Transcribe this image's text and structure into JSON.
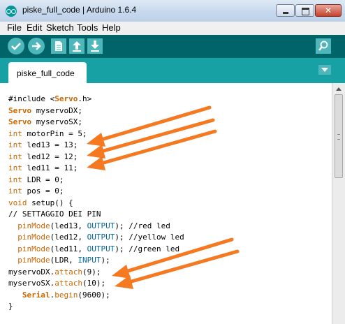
{
  "window": {
    "title": "piske_full_code | Arduino 1.6.4"
  },
  "menu": {
    "items": [
      "File",
      "Edit",
      "Sketch",
      "Tools",
      "Help"
    ]
  },
  "toolbar": {
    "verify_icon": "check-icon",
    "upload_icon": "arrow-right-icon",
    "new_icon": "new-document-icon",
    "open_icon": "arrow-up-icon",
    "save_icon": "arrow-down-icon",
    "serial_monitor_icon": "magnifier-icon"
  },
  "tabs": {
    "active": "piske_full_code"
  },
  "code": {
    "lines": [
      [
        {
          "t": "#include <",
          "s": "plain"
        },
        {
          "t": "Servo",
          "s": "class"
        },
        {
          "t": ".h>",
          "s": "plain"
        }
      ],
      [
        {
          "t": "Servo",
          "s": "class"
        },
        {
          "t": " myservoDX;",
          "s": "plain"
        }
      ],
      [
        {
          "t": "Servo",
          "s": "class"
        },
        {
          "t": " myservoSX;",
          "s": "plain"
        }
      ],
      [
        {
          "t": "int",
          "s": "type"
        },
        {
          "t": " motorPin = 5;",
          "s": "plain"
        }
      ],
      [
        {
          "t": "int",
          "s": "type"
        },
        {
          "t": " led13 = 13;",
          "s": "plain"
        }
      ],
      [
        {
          "t": "int",
          "s": "type"
        },
        {
          "t": " led12 = 12;",
          "s": "plain"
        }
      ],
      [
        {
          "t": "int",
          "s": "type"
        },
        {
          "t": " led11 = 11;",
          "s": "plain"
        }
      ],
      [
        {
          "t": "int",
          "s": "type"
        },
        {
          "t": " LDR = 0;",
          "s": "plain"
        }
      ],
      [
        {
          "t": "int",
          "s": "type"
        },
        {
          "t": " pos = 0;",
          "s": "plain"
        }
      ],
      [
        {
          "t": "void",
          "s": "type"
        },
        {
          "t": " setup",
          "s": "plain"
        },
        {
          "t": "() {",
          "s": "plain"
        }
      ],
      [
        {
          "t": "// SETTAGGIO DEI PIN",
          "s": "plain"
        }
      ],
      [
        {
          "t": "  ",
          "s": "plain"
        },
        {
          "t": "pinMode",
          "s": "type"
        },
        {
          "t": "(led13, ",
          "s": "plain"
        },
        {
          "t": "OUTPUT",
          "s": "const"
        },
        {
          "t": "); ",
          "s": "plain"
        },
        {
          "t": "//red led",
          "s": "plain"
        }
      ],
      [
        {
          "t": "  ",
          "s": "plain"
        },
        {
          "t": "pinMode",
          "s": "type"
        },
        {
          "t": "(led12, ",
          "s": "plain"
        },
        {
          "t": "OUTPUT",
          "s": "const"
        },
        {
          "t": "); ",
          "s": "plain"
        },
        {
          "t": "//yellow led",
          "s": "plain"
        }
      ],
      [
        {
          "t": "  ",
          "s": "plain"
        },
        {
          "t": "pinMode",
          "s": "type"
        },
        {
          "t": "(led11, ",
          "s": "plain"
        },
        {
          "t": "OUTPUT",
          "s": "const"
        },
        {
          "t": "); ",
          "s": "plain"
        },
        {
          "t": "//green led",
          "s": "plain"
        }
      ],
      [
        {
          "t": "  ",
          "s": "plain"
        },
        {
          "t": "pinMode",
          "s": "type"
        },
        {
          "t": "(LDR, ",
          "s": "plain"
        },
        {
          "t": "INPUT",
          "s": "const"
        },
        {
          "t": ");",
          "s": "plain"
        }
      ],
      [
        {
          "t": "myservoDX.",
          "s": "plain"
        },
        {
          "t": "attach",
          "s": "type"
        },
        {
          "t": "(9);",
          "s": "plain"
        }
      ],
      [
        {
          "t": "myservoSX.",
          "s": "plain"
        },
        {
          "t": "attach",
          "s": "type"
        },
        {
          "t": "(10);",
          "s": "plain"
        }
      ],
      [
        {
          "t": "   ",
          "s": "plain"
        },
        {
          "t": "Serial",
          "s": "class"
        },
        {
          "t": ".",
          "s": "plain"
        },
        {
          "t": "begin",
          "s": "type"
        },
        {
          "t": "(9600);",
          "s": "plain"
        }
      ],
      [
        {
          "t": "}",
          "s": "plain"
        }
      ]
    ]
  },
  "colors": {
    "toolbar_bg": "#006468",
    "tabbar_bg": "#17a1a5",
    "button_bg": "#4db7bb",
    "annotation_arrow": "#f47920",
    "keyword": "#cc6600",
    "constant": "#006699"
  }
}
